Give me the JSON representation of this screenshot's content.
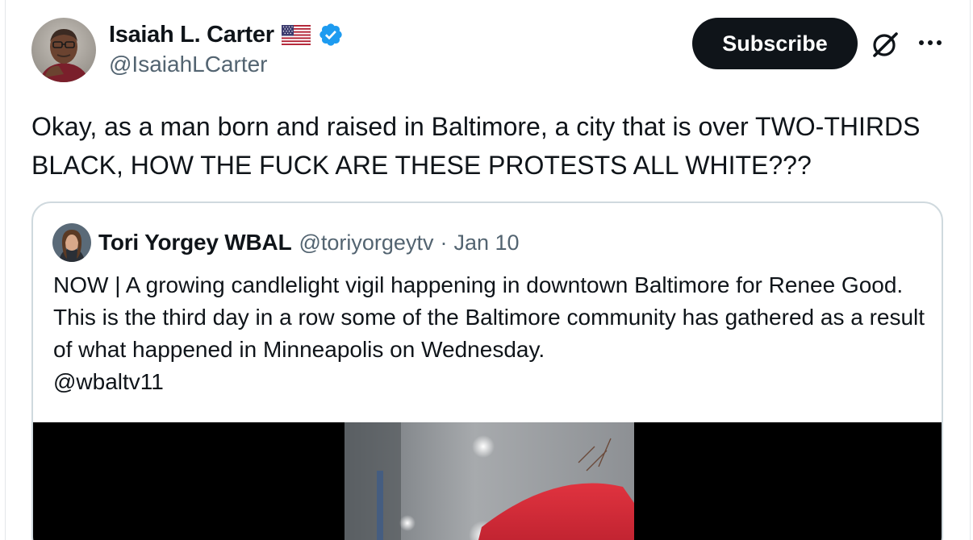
{
  "author": {
    "name": "Isaiah L. Carter",
    "handle": "@IsaiahLCarter",
    "flag_icon": "us-flag-icon",
    "verified_icon": "verified-badge-icon",
    "verified_color": "#1d9bf0"
  },
  "actions": {
    "subscribe_label": "Subscribe",
    "grok_icon": "grok-icon",
    "more_icon": "more-options-icon"
  },
  "tweet": {
    "text": "Okay, as a man born and raised in Baltimore, a city that is over TWO-THIRDS BLACK, HOW THE FUCK ARE THESE PROTESTS ALL WHITE???"
  },
  "quote": {
    "name": "Tori Yorgey WBAL",
    "handle": "@toriyorgeytv",
    "separator": "·",
    "date": "Jan 10",
    "text": "NOW | A growing candlelight vigil happening in downtown Baltimore for Renee Good. This is the third day in a row some of the Baltimore community has gathered as a result of what happened in Minneapolis on Wednesday.",
    "mention": "@wbaltv11"
  },
  "colors": {
    "primary_text": "#0f1419",
    "secondary_text": "#536471",
    "border": "#cfd9de",
    "button_bg": "#0f1419",
    "button_text": "#ffffff"
  }
}
